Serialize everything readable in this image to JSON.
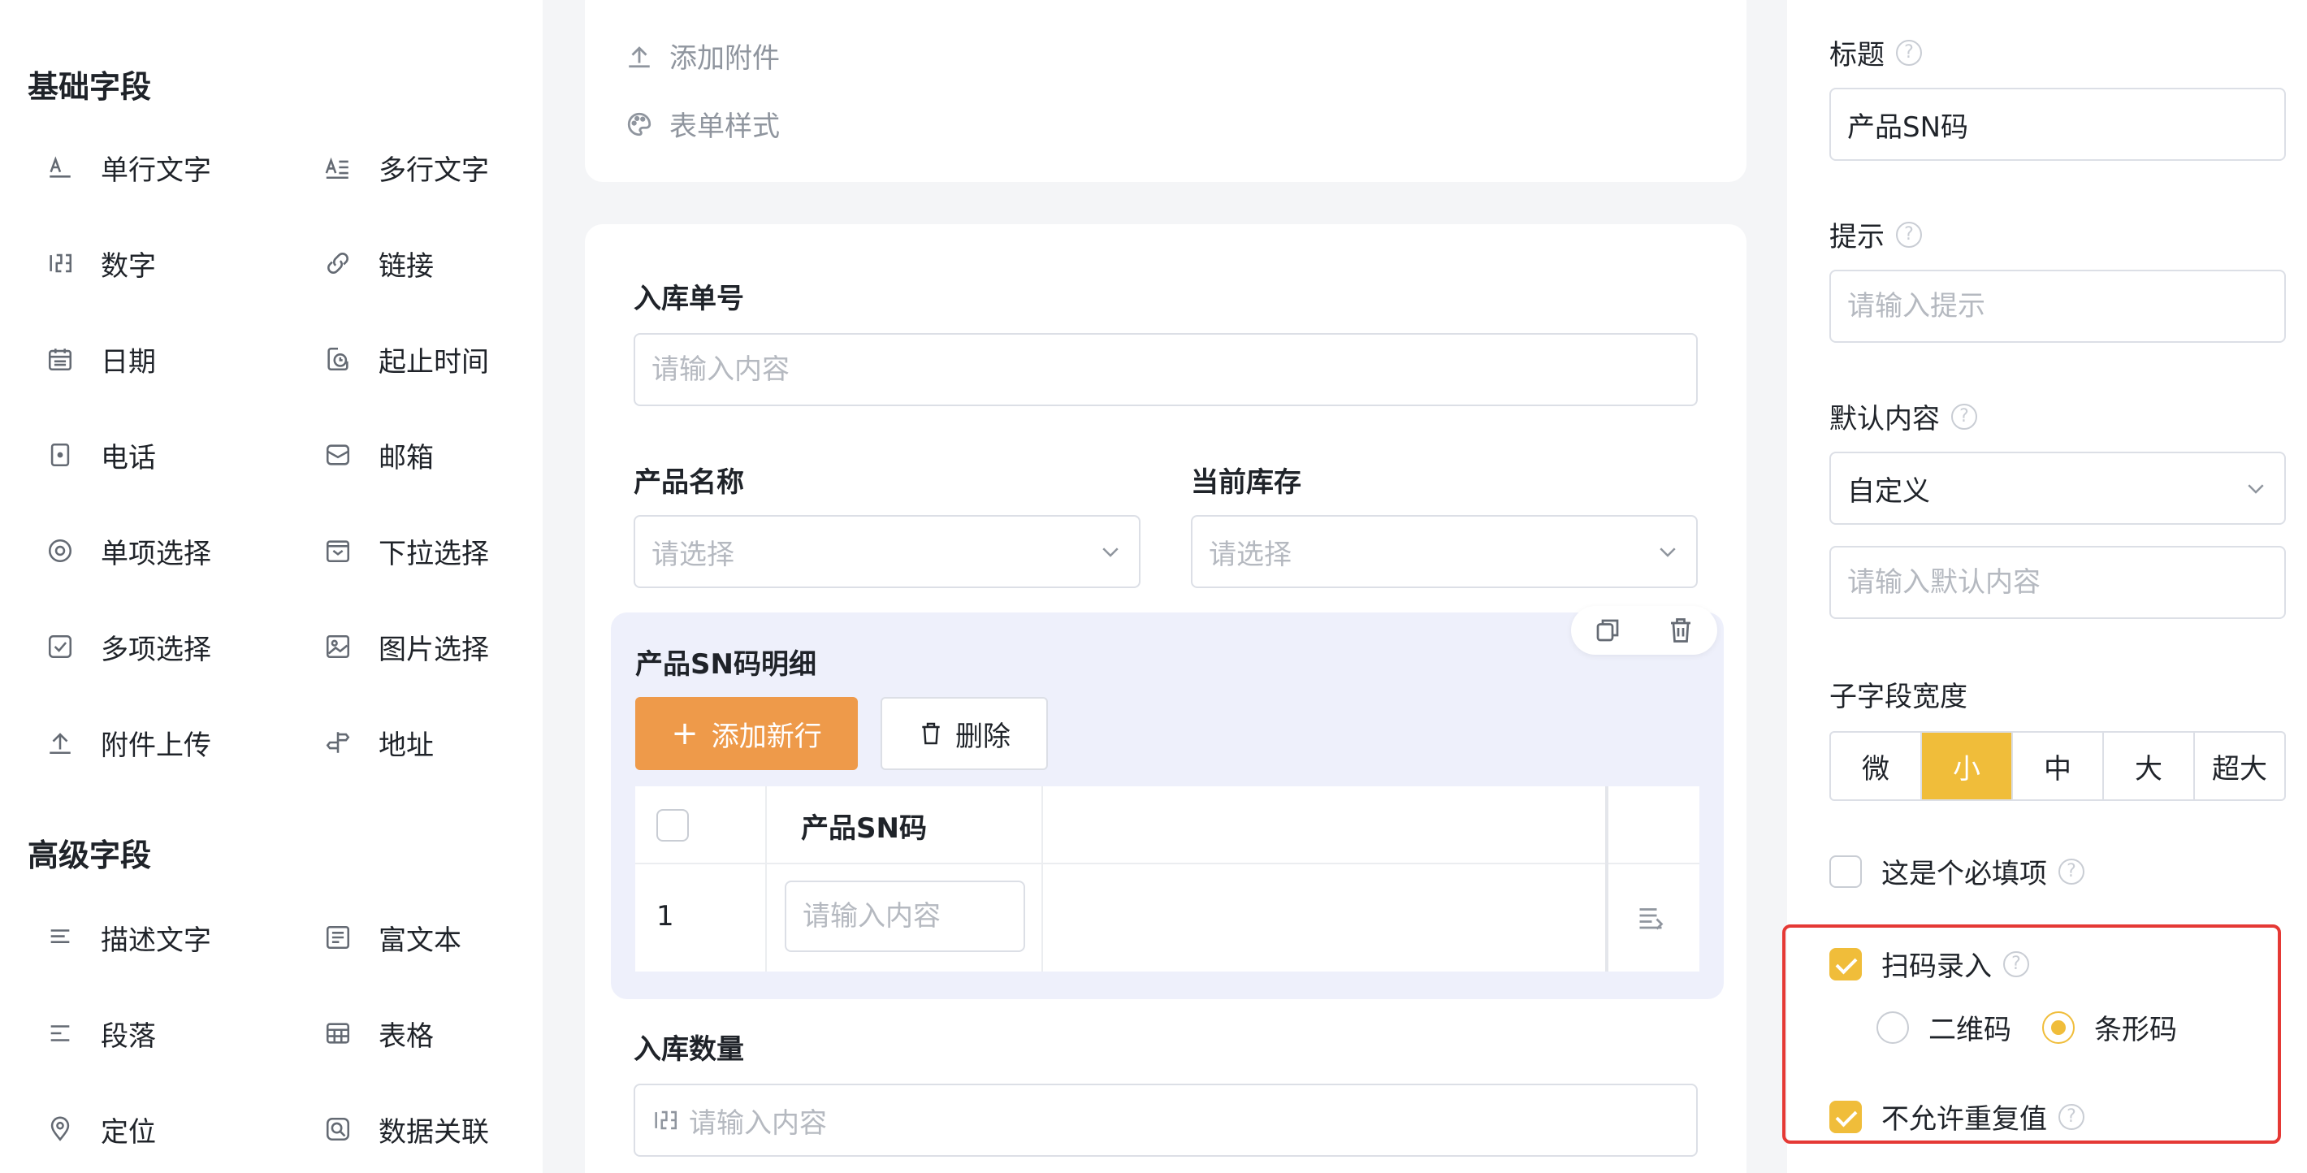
{
  "left_panel": {
    "basic_title": "基础字段",
    "basic_fields": [
      {
        "label": "单行文字",
        "icon": "single-line-text-icon"
      },
      {
        "label": "多行文字",
        "icon": "multi-line-text-icon"
      },
      {
        "label": "数字",
        "icon": "number-icon"
      },
      {
        "label": "链接",
        "icon": "link-icon"
      },
      {
        "label": "日期",
        "icon": "calendar-icon"
      },
      {
        "label": "起止时间",
        "icon": "time-range-icon"
      },
      {
        "label": "电话",
        "icon": "phone-icon"
      },
      {
        "label": "邮箱",
        "icon": "mail-icon"
      },
      {
        "label": "单项选择",
        "icon": "radio-icon"
      },
      {
        "label": "下拉选择",
        "icon": "dropdown-icon"
      },
      {
        "label": "多项选择",
        "icon": "checkbox-icon"
      },
      {
        "label": "图片选择",
        "icon": "image-icon"
      },
      {
        "label": "附件上传",
        "icon": "upload-icon"
      },
      {
        "label": "地址",
        "icon": "signpost-icon"
      }
    ],
    "advanced_title": "高级字段",
    "advanced_fields": [
      {
        "label": "描述文字",
        "icon": "description-icon"
      },
      {
        "label": "富文本",
        "icon": "rich-text-icon"
      },
      {
        "label": "段落",
        "icon": "paragraph-icon"
      },
      {
        "label": "表格",
        "icon": "table-icon"
      },
      {
        "label": "定位",
        "icon": "location-pin-icon"
      },
      {
        "label": "数据关联",
        "icon": "data-link-icon"
      }
    ]
  },
  "toolbar": {
    "add_attachment": "添加附件",
    "form_style": "表单样式"
  },
  "form": {
    "inbound_no_label": "入库单号",
    "inbound_no_placeholder": "请输入内容",
    "product_name_label": "产品名称",
    "product_name_placeholder": "请选择",
    "stock_label": "当前库存",
    "stock_placeholder": "请选择",
    "subform": {
      "title": "产品SN码明细",
      "add_row": "添加新行",
      "delete": "删除",
      "column_header": "产品SN码",
      "row_index": "1",
      "cell_placeholder": "请输入内容"
    },
    "quantity_label": "入库数量",
    "quantity_placeholder": "请输入内容"
  },
  "properties": {
    "title_label": "标题",
    "title_value": "产品SN码",
    "hint_label": "提示",
    "hint_placeholder": "请输入提示",
    "default_label": "默认内容",
    "default_mode": "自定义",
    "default_placeholder": "请输入默认内容",
    "width_label": "子字段宽度",
    "width_options": [
      "微",
      "小",
      "中",
      "大",
      "超大"
    ],
    "width_selected": "小",
    "required_label": "这是个必填项",
    "required_checked": false,
    "scan_label": "扫码录入",
    "scan_checked": true,
    "scan_options": [
      "二维码",
      "条形码"
    ],
    "scan_selected": "条形码",
    "no_duplicate_label": "不允许重复值",
    "no_duplicate_checked": true
  },
  "colors": {
    "accent": "#f0bd3a",
    "button_orange": "#ee9a4a",
    "highlight_border": "#e53935"
  }
}
